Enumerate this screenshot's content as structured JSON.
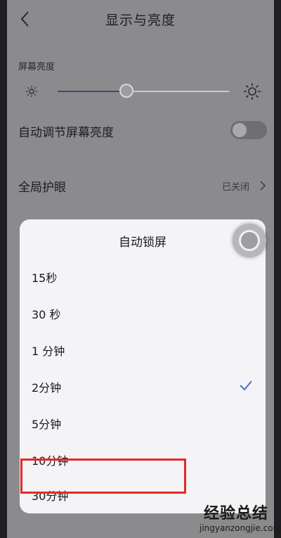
{
  "header": {
    "title": "显示与亮度"
  },
  "brightness": {
    "section_label": "屏幕亮度",
    "level_percent": 40
  },
  "auto_brightness": {
    "label": "自动调节屏幕亮度",
    "enabled": false
  },
  "eye_care": {
    "label": "全局护眼",
    "status": "已关闭"
  },
  "dialog": {
    "title": "自动锁屏",
    "options": [
      {
        "label": "15秒",
        "selected": false
      },
      {
        "label": "30 秒",
        "selected": false
      },
      {
        "label": "1 分钟",
        "selected": false
      },
      {
        "label": "2分钟",
        "selected": true
      },
      {
        "label": "5分钟",
        "selected": false
      },
      {
        "label": "10分钟",
        "selected": false
      },
      {
        "label": "30分钟",
        "selected": false
      }
    ],
    "highlighted_option": "30分钟"
  },
  "watermark": {
    "top": "经验总结",
    "bottom": "jingyanzongjie.com"
  },
  "colors": {
    "accent": "#3c4a78",
    "check": "#4a6fd8",
    "highlight": "#e22a2a"
  }
}
